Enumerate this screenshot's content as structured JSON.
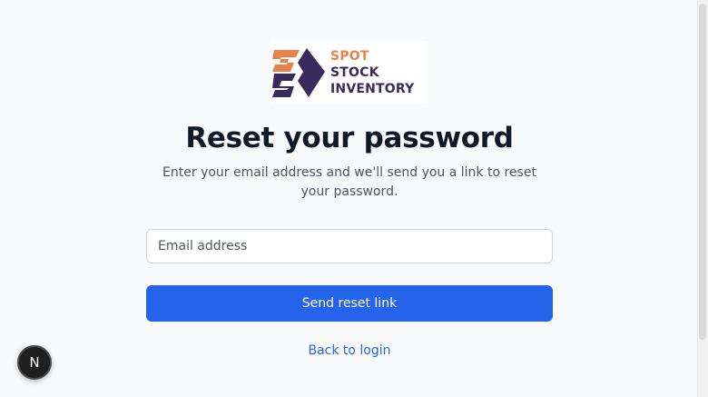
{
  "logo": {
    "line1": "SPOT",
    "line2": "STOCK",
    "line3": "INVENTORY",
    "colors": {
      "orange": "#e8814a",
      "purple": "#3a2b5e"
    }
  },
  "heading": {
    "title": "Reset your password",
    "subtitle": "Enter your email address and we'll send you a link to reset your password."
  },
  "form": {
    "email_placeholder": "Email address",
    "email_value": "",
    "submit_label": "Send reset link"
  },
  "links": {
    "back_to_login": "Back to login"
  },
  "dev_badge": {
    "letter": "N"
  },
  "colors": {
    "primary": "#2563eb",
    "background": "#f9fafb"
  }
}
